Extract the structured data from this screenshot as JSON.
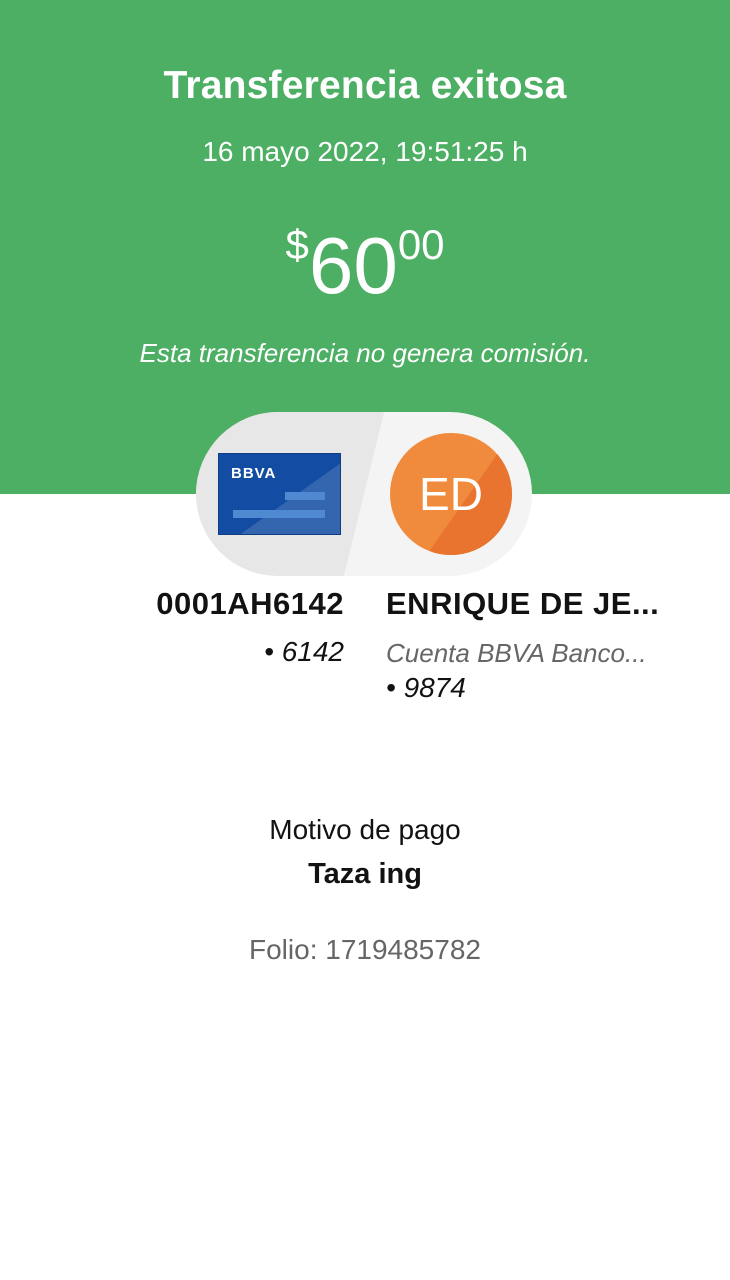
{
  "header": {
    "title": "Transferencia exitosa",
    "datetime": "16 mayo 2022, 19:51:25 h",
    "amount": {
      "currency_symbol": "$",
      "integer": "60",
      "decimals": "00"
    },
    "commission_note": "Esta transferencia no genera comisión."
  },
  "origin": {
    "card_brand": "BBVA",
    "account_name": "0001AH6142",
    "account_number": "• 6142"
  },
  "destination": {
    "initials": "ED",
    "name": "ENRIQUE DE JE...",
    "bank": "Cuenta BBVA Banco...",
    "account_number": "• 9874"
  },
  "details": {
    "reason_label": "Motivo de pago",
    "reason_value": "Taza ing",
    "folio": "Folio: 1719485782"
  },
  "colors": {
    "header_bg": "#4caf64",
    "card_blue": "#134da3",
    "avatar_orange": "#f08a3c"
  },
  "icons": [
    "bbva-card-icon",
    "contact-avatar"
  ]
}
